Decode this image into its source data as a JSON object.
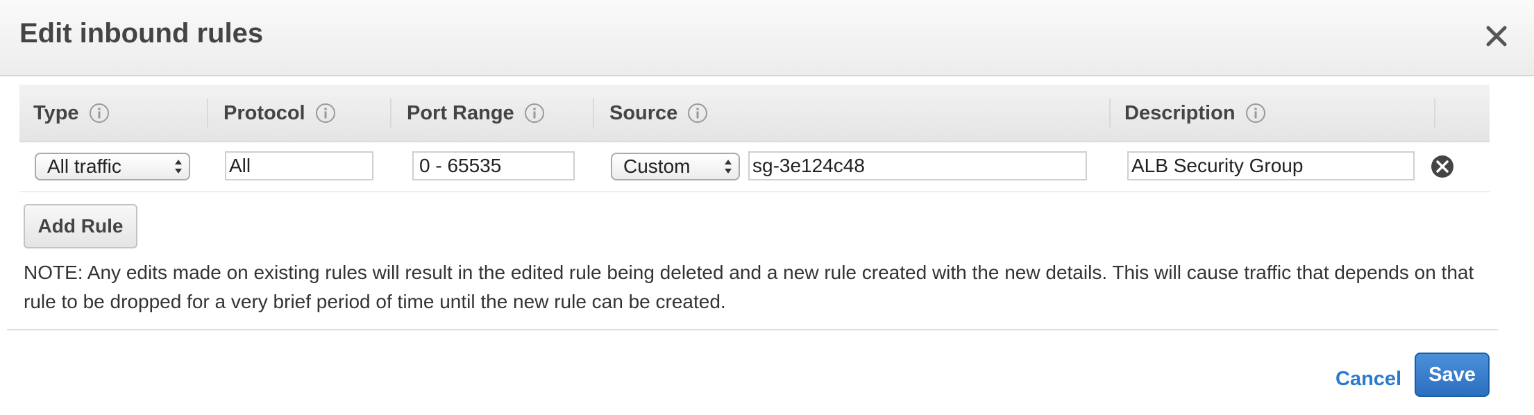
{
  "dialog": {
    "title": "Edit inbound rules",
    "close_icon": "close-icon"
  },
  "table": {
    "headers": {
      "type": "Type",
      "protocol": "Protocol",
      "port_range": "Port Range",
      "source": "Source",
      "description": "Description"
    },
    "info_icon": "info-icon",
    "rows": [
      {
        "type": "All traffic",
        "protocol": "All",
        "port_range": "0 - 65535",
        "source_type": "Custom",
        "source_value": "sg-3e124c48",
        "description": "ALB Security Group",
        "remove_icon": "remove-circle-icon"
      }
    ]
  },
  "add_rule_label": "Add Rule",
  "note": "NOTE: Any edits made on existing rules will result in the edited rule being deleted and a new rule created with the new details. This will cause traffic that depends on that rule to be dropped for a very brief period of time until the new rule can be created.",
  "footer": {
    "cancel_label": "Cancel",
    "save_label": "Save"
  },
  "colors": {
    "link": "#2a7bd0",
    "primary_button": "#2c6fbf",
    "header_bg": "#ececec"
  }
}
